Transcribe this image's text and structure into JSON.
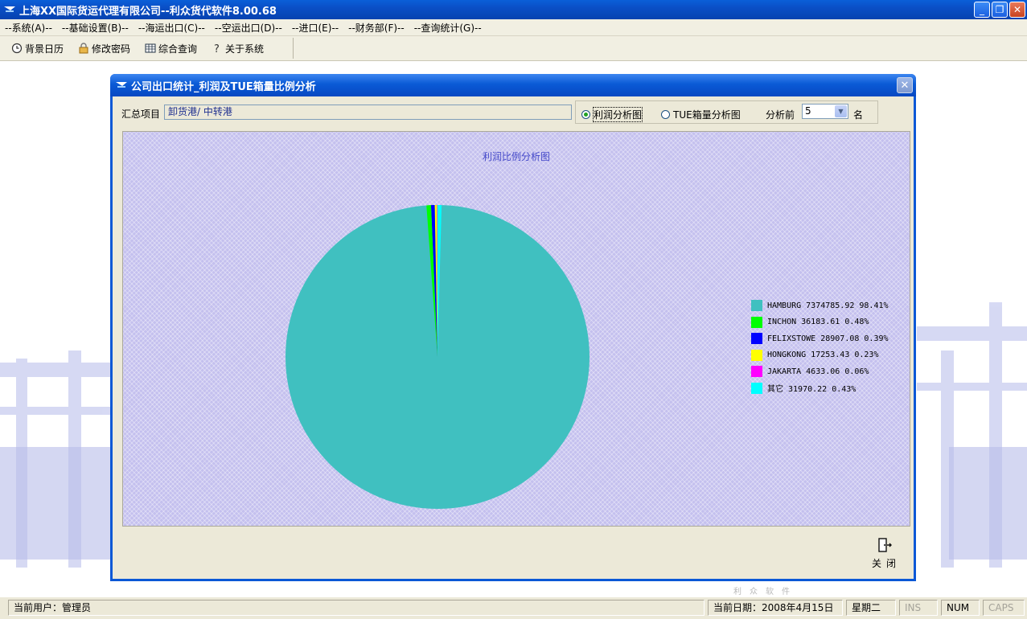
{
  "window": {
    "title": "上海XX国际货运代理有限公司--利众货代软件8.00.68",
    "buttons": {
      "minimize": "_",
      "restore": "❐",
      "close": "✕"
    }
  },
  "menu": [
    "--系统(A)--",
    "--基础设置(B)--",
    "--海运出口(C)--",
    "--空运出口(D)--",
    "--进口(E)--",
    "--财务部(F)--",
    "--查询统计(G)--"
  ],
  "toolbar": {
    "calendar": "背景日历",
    "password": "修改密码",
    "query": "综合查询",
    "about": "关于系统"
  },
  "dialog": {
    "title": "公司出口统计_利润及TUE箱量比例分析",
    "summary_label": "汇总项目",
    "summary_value": "卸货港/ 中转港",
    "radio_profit": "利润分析图",
    "radio_tue": "TUE箱量分析图",
    "topn_label": "分析前",
    "topn_value": "5",
    "topn_unit": "名",
    "close_label": "关闭"
  },
  "chart_data": {
    "type": "pie",
    "title": "利润比例分析图",
    "slices": [
      {
        "name": "HAMBURG",
        "value": 7374785.92,
        "percent": "98.41%",
        "color": "#40c0c0"
      },
      {
        "name": "INCHON",
        "value": 36183.61,
        "percent": "0.48%",
        "color": "#00ff00"
      },
      {
        "name": "FELIXSTOWE",
        "value": 28907.08,
        "percent": "0.39%",
        "color": "#0000ff"
      },
      {
        "name": "HONGKONG",
        "value": 17253.43,
        "percent": "0.23%",
        "color": "#ffff00"
      },
      {
        "name": "JAKARTA",
        "value": 4633.06,
        "percent": "0.06%",
        "color": "#ff00ff"
      },
      {
        "name": "其它",
        "value": 31970.22,
        "percent": "0.43%",
        "color": "#00ffff"
      }
    ],
    "legend": [
      "HAMBURG 7374785.92 98.41%",
      "INCHON 36183.61  0.48%",
      "FELIXSTOWE 28907.08  0.39%",
      "HONGKONG 17253.43  0.23%",
      "JAKARTA 4633.06  0.06%",
      "其它 31970.22  0.43%"
    ]
  },
  "watermark": "利众软件",
  "status": {
    "user": "当前用户：管理员",
    "date": "当前日期：2008年4月15日",
    "weekday": "星期二",
    "ins": "INS",
    "num": "NUM",
    "caps": "CAPS"
  }
}
